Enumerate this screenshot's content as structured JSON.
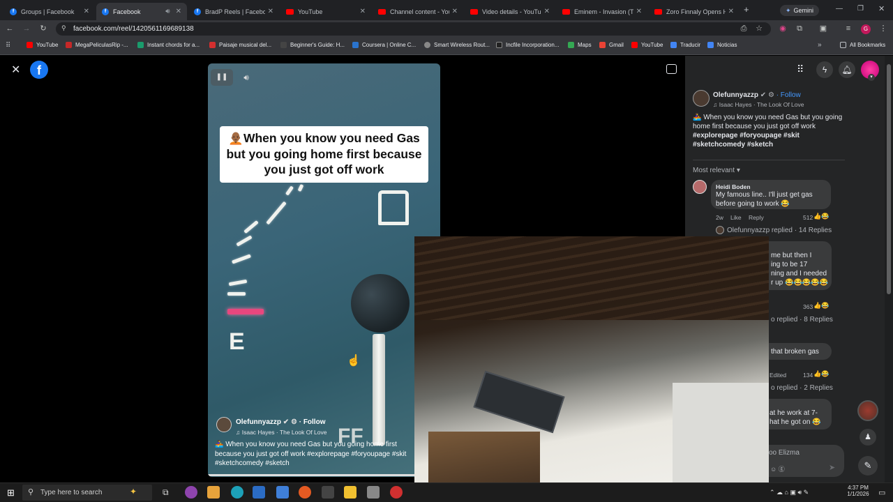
{
  "tabs": [
    {
      "title": "Groups | Facebook",
      "icon": "facebook-icon"
    },
    {
      "title": "Facebook",
      "icon": "facebook-icon",
      "active": true
    },
    {
      "title": "BradP Reels | Facebook",
      "icon": "facebook-icon"
    },
    {
      "title": "YouTube",
      "icon": "youtube-icon"
    },
    {
      "title": "Channel content - YouT",
      "icon": "youtube-studio-icon"
    },
    {
      "title": "Video details - YouTub",
      "icon": "youtube-studio-icon"
    },
    {
      "title": "Eminem - Invasion (Th",
      "icon": "youtube-icon"
    },
    {
      "title": "Zoro Finnaly Opens Hi",
      "icon": "youtube-icon"
    }
  ],
  "gemini_label": "Gemini",
  "url": "facebook.com/reel/1420561169689138",
  "bookmarks": [
    "YouTube",
    "MegaPeliculasRip -...",
    "Instant chords for a...",
    "Paisaje musical del...",
    "Beginner's Guide: H...",
    "Coursera | Online C...",
    "Smart Wireless Rout...",
    "Incfile Incorporation...",
    "Maps",
    "Gmail",
    "YouTube",
    "Traducir",
    "Noticias"
  ],
  "all_bookmarks": "All Bookmarks",
  "reel": {
    "caption_overlay": "🧑🏾‍🦲When you know you need Gas but you going home first because you just got off work",
    "author": "Olefunnyazzp",
    "follow": "Follow",
    "song": "♫ Isaac Hayes · The Look Of Love",
    "description": "🚣‍♀️ When you know you need Gas but you going home first because you just got off work  #explorepage #foryoupage #skit #sketchcomedy #sketch",
    "gauge_e": "E",
    "gauge_f": "FF"
  },
  "side": {
    "author": "Olefunnyazzp",
    "follow": "· Follow",
    "song": "♫ Isaac Hayes · The Look Of Love",
    "description_line1": "🚣‍♀️ When you know you need Gas but you going",
    "description_line2": "home first because you just got off work",
    "tags_line1": "#explorepage #foryoupage #skit",
    "tags_line2": "#sketchcomedy #sketch",
    "sort": "Most relevant",
    "comments": [
      {
        "author": "Heidi Boden",
        "text_line1": "My famous line.. I'll just get gas",
        "text_line2": "before going to work 😂",
        "time": "2w",
        "like": "Like",
        "reply": "Reply",
        "count": "512",
        "replies": "Olefunnyazzp replied · 14 Replies"
      },
      {
        "text_line1": "me but then I",
        "text_line2": "ing to be 17",
        "text_line3": "ning and I needed",
        "text_line4": "r up 😂😂😂😂😂",
        "count": "363",
        "replies": "o replied · 8 Replies"
      },
      {
        "text_line1": "that broken gas",
        "edited": "Edited",
        "count": "134",
        "replies": "o replied · 2 Replies"
      },
      {
        "text_line1": "at he work at 7-",
        "text_line2": "hat he got on 😂"
      }
    ],
    "reply_placeholder": "oo Elizma"
  },
  "taskbar": {
    "search": "Type here to search",
    "time": "4:37 PM",
    "date": "1/1/2026"
  }
}
